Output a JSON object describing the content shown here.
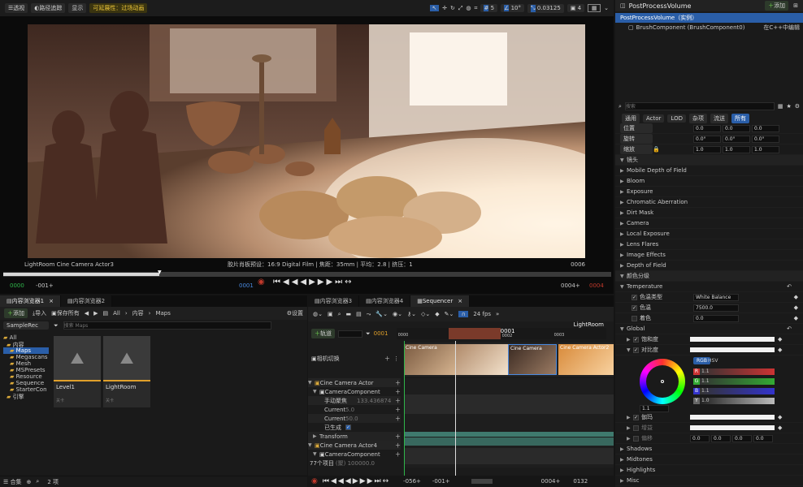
{
  "viewport": {
    "toolbar_left": [
      "透视",
      "路径追踪",
      "显示"
    ],
    "visibility_label": "可延展性：过场动画",
    "toolbar_right": {
      "grid": "5",
      "angle": "10°",
      "scale": "0.03125",
      "cam": "4"
    },
    "camera_name": "LightRoom Cine Camera Actor3",
    "film_info": "胶片肖板预设：16:9 Digital Film | 焦距：35mm | 平均：2.8 | 挤压：1",
    "frame": "0006",
    "transport": {
      "start": "0000",
      "in": "-001+",
      "current": "0001",
      "out": "0004+",
      "end": "0004"
    }
  },
  "details": {
    "title": "PostProcessVolume",
    "add_label": "添加",
    "tree": {
      "root": "PostProcessVolume（实例）",
      "child": "BrushComponent (BrushComponent0)",
      "edit_link": "在C++中编辑"
    },
    "search_placeholder": "搜索",
    "filters": [
      "通用",
      "Actor",
      "LOD",
      "杂项",
      "流送",
      "所有"
    ],
    "transform": [
      {
        "label": "位置",
        "v": [
          "0.0",
          "0.0",
          "0.0"
        ]
      },
      {
        "label": "旋转",
        "v": [
          "0.0°",
          "0.0°",
          "0.0°"
        ]
      },
      {
        "label": "缩放",
        "v": [
          "1.0",
          "1.0",
          "1.0"
        ]
      }
    ],
    "section_lens": "镜头",
    "lens_items": [
      "Mobile Depth of Field",
      "Bloom",
      "Exposure",
      "Chromatic Aberration",
      "Dirt Mask",
      "Camera",
      "Local Exposure",
      "Lens Flares",
      "Image Effects",
      "Depth of Field"
    ],
    "section_color": "颜色分级",
    "temperature": "Temperature",
    "temp_rows": [
      {
        "label": "色温类型",
        "value": "White Balance"
      },
      {
        "label": "色温",
        "value": "7500.0"
      },
      {
        "label": "着色",
        "value": "0.0"
      }
    ],
    "global": "Global",
    "saturation": "饱和度",
    "contrast": "对比度",
    "wheel": {
      "rgb": "RGB",
      "hsv": "HSV",
      "value": "1.1",
      "channels": [
        {
          "k": "R",
          "v": "1.1"
        },
        {
          "k": "G",
          "v": "1.1"
        },
        {
          "k": "B",
          "v": "1.1"
        },
        {
          "k": "Y",
          "v": "1.0"
        }
      ]
    },
    "gamma": "伽玛",
    "gain": "增益",
    "offset": "偏移",
    "offset_values": [
      "0.0",
      "0.0",
      "0.0",
      "0.0"
    ],
    "tail": [
      "Shadows",
      "Midtones",
      "Highlights",
      "Misc"
    ]
  },
  "content_browser": {
    "tabs": [
      "内容浏览器1",
      "内容浏览器2"
    ],
    "add": "添加",
    "import": "导入",
    "save_all": "保存所有",
    "path": [
      "All",
      "内容",
      "Maps"
    ],
    "settings": "设置",
    "project": "SampleRec",
    "search_placeholder": "搜索 Maps",
    "tree": [
      "All",
      "内容",
      "Maps",
      "Megascans",
      "Mesh",
      "MSPresets",
      "Resource",
      "Sequence",
      "StarterCon",
      "引擎"
    ],
    "assets": [
      {
        "name": "Level1",
        "type": "关卡"
      },
      {
        "name": "LightRoom",
        "type": "关卡"
      }
    ],
    "collections": "合集",
    "count": "2 项"
  },
  "sequencer": {
    "tabs": [
      "内容浏览器3",
      "内容浏览器4",
      "Sequencer"
    ],
    "fps": "24 fps",
    "sequence_name": "LightRoom",
    "add_track": "轨道",
    "frame_field": "0001",
    "ruler": [
      "0000",
      "0001",
      "0002",
      "0003"
    ],
    "camera_cut": "相机切换",
    "shots": [
      "Cine Camera",
      "",
      "Cine Camera",
      "Cine Camera Actor2"
    ],
    "tracks": [
      {
        "label": "Cine Camera Actor",
        "indent": 0
      },
      {
        "label": "CameraComponent",
        "indent": 1
      },
      {
        "label": "手动聚焦",
        "value": "133.436874",
        "indent": 2
      },
      {
        "label": "Current",
        "value": "5.0",
        "indent": 2
      },
      {
        "label": "Current",
        "value": "50.0",
        "indent": 2
      },
      {
        "label": "已生成",
        "indent": 2
      },
      {
        "label": "Transform",
        "indent": 1
      },
      {
        "label": "Cine Camera Actor4",
        "indent": 0
      },
      {
        "label": "CameraComponent",
        "indent": 1
      }
    ],
    "footer_count": "77个项目",
    "footer_extra": "(聚) 100000.0",
    "transport": {
      "start": "-056+",
      "in": "-001+",
      "out": "0004+",
      "end": "0132"
    }
  },
  "colors": {
    "accent": "#f0c83a",
    "selection": "#2a5ea8",
    "playhead": "#c0392b",
    "track_green": "#3f7a6e"
  }
}
